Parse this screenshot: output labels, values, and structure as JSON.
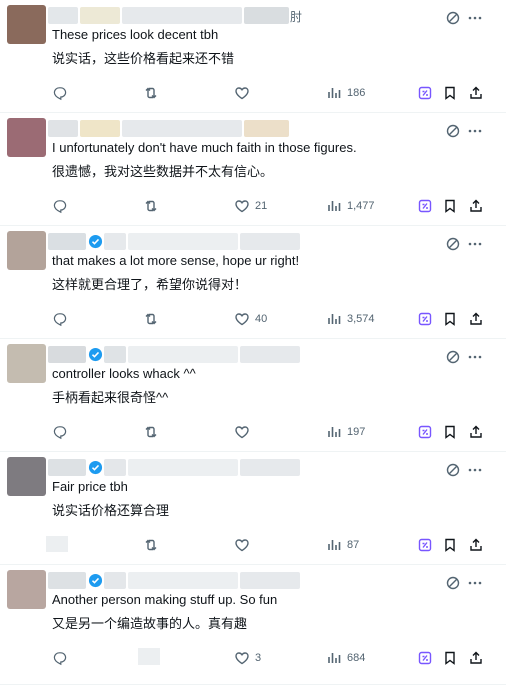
{
  "colors": {
    "text": "#0f1419",
    "muted": "#536471",
    "grok_purple": "#7856ff",
    "verified_blue": "#1d9bf0",
    "divider": "#eff3f4"
  },
  "icons": {
    "grok": "grok-icon",
    "more": "more-dots-icon",
    "reply": "reply-icon",
    "repost": "repost-icon",
    "like": "heart-icon",
    "views": "views-icon",
    "bookmark": "bookmark-icon",
    "share": "share-icon",
    "verified": "verified-badge-icon"
  },
  "posts": [
    {
      "text_en": "These prices look decent tbh",
      "text_zh": "说实话，这些价格看起来还不错",
      "likes": "",
      "views": "186",
      "verified": false,
      "name_suffix": "肘"
    },
    {
      "text_en": "I unfortunately don't have much faith in those figures.",
      "text_zh": "很遗憾，我对这些数据并不太有信心。",
      "likes": "21",
      "views": "1,477",
      "verified": false
    },
    {
      "text_en": "that makes a lot more sense, hope ur right!",
      "text_zh": "这样就更合理了，希望你说得对！",
      "likes": "40",
      "views": "3,574",
      "verified": true
    },
    {
      "text_en": "controller looks whack ^^",
      "text_zh": "手柄看起来很奇怪^^",
      "likes": "",
      "views": "197",
      "verified": true
    },
    {
      "text_en": "Fair price tbh",
      "text_zh": "说实话价格还算合理",
      "likes": "",
      "views": "87",
      "verified": true
    },
    {
      "text_en": "Another person making stuff up. So fun",
      "text_zh": "又是另一个编造故事的人。真有趣",
      "likes": "3",
      "views": "684",
      "verified": true
    }
  ]
}
